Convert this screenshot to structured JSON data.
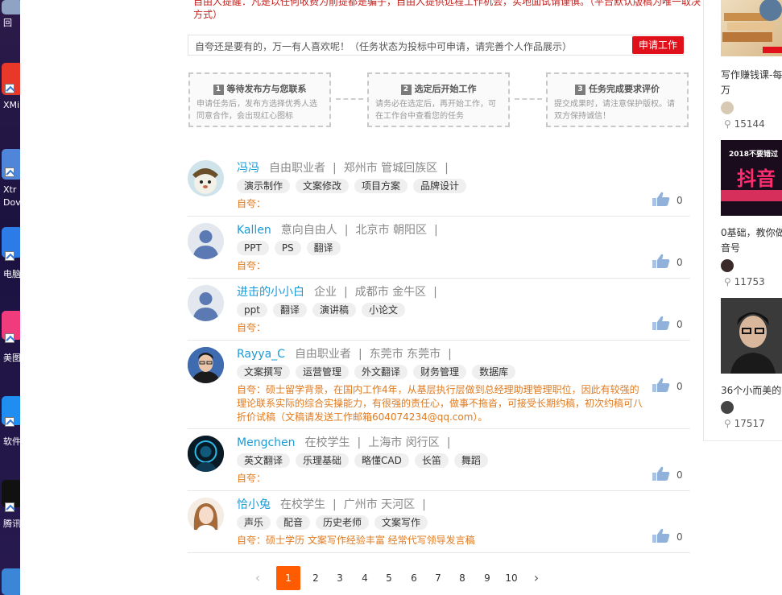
{
  "desktop": {
    "labels": [
      "回",
      "XMin",
      "Xtr",
      "Dov",
      "电脑",
      "美图",
      "软件",
      "腾讯"
    ]
  },
  "top_notice": "自由人提醒：凡是以任何收费为前提都是骗子，自由人提供远程工作机会，实地面试请谨慎。（平台默认版稿为唯一取决方式）",
  "pitch": {
    "text": "自夸还是要有的，万一有人喜欢呢！（任务状态为投标中可申请，请完善个人作品展示）",
    "apply_label": "申请工作"
  },
  "steps": [
    {
      "num": "1",
      "title": "等待发布方与您联系",
      "desc": "申请任务后，发布方选择优秀人选同意合作，会出现红心图标"
    },
    {
      "num": "2",
      "title": "选定后开始工作",
      "desc": "请务必在选定后，再开始工作，可在工作台中查看您的任务"
    },
    {
      "num": "3",
      "title": "任务完成要求评价",
      "desc": "提交成果时，请注意保护版权。请双方保持诚信！"
    }
  ],
  "applicants": [
    {
      "name": "冯冯",
      "role": "自由职业者",
      "location": "郑州市 管城回族区",
      "tags": [
        "演示制作",
        "文案修改",
        "项目方案",
        "品牌设计"
      ],
      "intro": "自夸：",
      "likes": "0"
    },
    {
      "name": "Kallen",
      "role": "意向自由人",
      "location": "北京市 朝阳区",
      "tags": [
        "PPT",
        "PS",
        "翻译"
      ],
      "intro": "自夸：",
      "likes": "0"
    },
    {
      "name": "进击的小小白",
      "role": "企业",
      "location": "成都市 金牛区",
      "tags": [
        "ppt",
        "翻译",
        "演讲稿",
        "小论文"
      ],
      "intro": "自夸：",
      "likes": "0"
    },
    {
      "name": "Rayya_C",
      "role": "自由职业者",
      "location": "东莞市 东莞市",
      "tags": [
        "文案撰写",
        "运营管理",
        "外文翻译",
        "财务管理",
        "数据库"
      ],
      "intro": "自夸：硕士留学背景，在国内工作4年，从基层执行层做到总经理助理管理职位，因此有较强的理论联系实际的综合实操能力，有很强的责任心，做事不拖沓，可接受长期约稿，初次约稿可八折价试稿（文稿请发送工作邮箱604074234@qq.com）。",
      "likes": "0"
    },
    {
      "name": "Mengchen",
      "role": "在校学生",
      "location": "上海市 闵行区",
      "tags": [
        "英文翻译",
        "乐理基础",
        "略懂CAD",
        "长笛",
        "舞蹈"
      ],
      "intro": "自夸：",
      "likes": "0"
    },
    {
      "name": "恰小兔",
      "role": "在校学生",
      "location": "广州市 天河区",
      "tags": [
        "声乐",
        "配音",
        "历史老师",
        "文案写作"
      ],
      "intro": "自夸：硕士学历 文案写作经验丰富 经常代写领导发言稿",
      "likes": "0"
    }
  ],
  "pagination": {
    "prev": "‹",
    "pages": [
      "1",
      "2",
      "3",
      "4",
      "5",
      "6",
      "7",
      "8",
      "9",
      "10"
    ],
    "current": "1",
    "next": "›"
  },
  "sidebar": {
    "items": [
      {
        "title_line1": "写作赚钱课-每",
        "title_line2": "万",
        "views": "15144"
      },
      {
        "title_line1": "0基础，教你做",
        "title_line2": "音号",
        "views": "11753"
      },
      {
        "title_line1": "36个小而美的",
        "title_line2": "",
        "views": "17517"
      }
    ],
    "thumb_texts": [
      "2018不要错过",
      "抖音"
    ]
  },
  "colors": {
    "accent": "#e1111b",
    "name_blue": "#1a9bd7",
    "intro_orange": "#e07a1f",
    "page_current": "#ff5b00"
  }
}
